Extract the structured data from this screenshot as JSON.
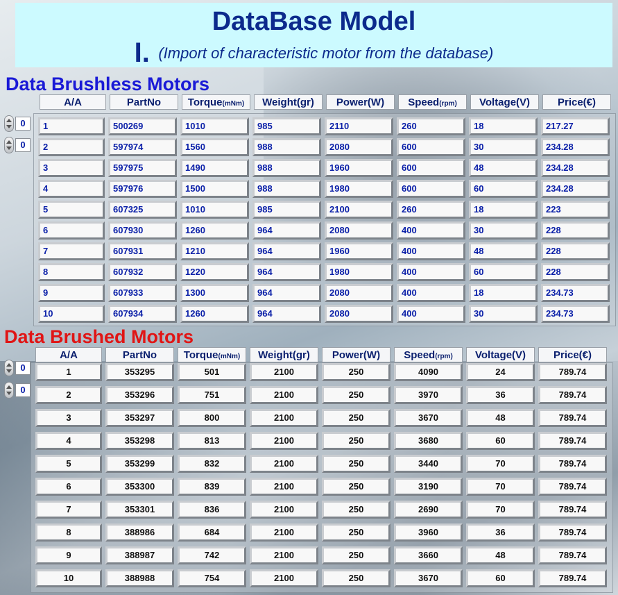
{
  "header": {
    "title": "DataBase Model",
    "roman": "I.",
    "subtitle": "(Import of characteristic motor from the database)"
  },
  "brushless": {
    "title": "Data Brushless Motors",
    "spinners": [
      "0",
      "0"
    ],
    "columns": [
      "A/A",
      "PartNo",
      "Torque",
      "Weight(gr)",
      "Power(W)",
      "Speed",
      "Voltage(V)",
      "Price(€)"
    ],
    "torque_unit": "(mNm)",
    "speed_unit": "(rpm)",
    "rows": [
      [
        "1",
        "500269",
        "1010",
        "985",
        "2110",
        "260",
        "18",
        "217.27"
      ],
      [
        "2",
        "597974",
        "1560",
        "988",
        "2080",
        "600",
        "30",
        "234.28"
      ],
      [
        "3",
        "597975",
        "1490",
        "988",
        "1960",
        "600",
        "48",
        "234.28"
      ],
      [
        "4",
        "597976",
        "1500",
        "988",
        "1980",
        "600",
        "60",
        "234.28"
      ],
      [
        "5",
        "607325",
        "1010",
        "985",
        "2100",
        "260",
        "18",
        "223"
      ],
      [
        "6",
        "607930",
        "1260",
        "964",
        "2080",
        "400",
        "30",
        "228"
      ],
      [
        "7",
        "607931",
        "1210",
        "964",
        "1960",
        "400",
        "48",
        "228"
      ],
      [
        "8",
        "607932",
        "1220",
        "964",
        "1980",
        "400",
        "60",
        "228"
      ],
      [
        "9",
        "607933",
        "1300",
        "964",
        "2080",
        "400",
        "18",
        "234.73"
      ],
      [
        "10",
        "607934",
        "1260",
        "964",
        "2080",
        "400",
        "30",
        "234.73"
      ]
    ]
  },
  "brushed": {
    "title": "Data Brushed Motors",
    "spinners": [
      "0",
      "0"
    ],
    "columns": [
      "A/A",
      "PartNo",
      "Torque",
      "Weight(gr)",
      "Power(W)",
      "Speed",
      "Voltage(V)",
      "Price(€)"
    ],
    "torque_unit": "(mNm)",
    "speed_unit": "(rpm)",
    "rows": [
      [
        "1",
        "353295",
        "501",
        "2100",
        "250",
        "4090",
        "24",
        "789.74"
      ],
      [
        "2",
        "353296",
        "751",
        "2100",
        "250",
        "3970",
        "36",
        "789.74"
      ],
      [
        "3",
        "353297",
        "800",
        "2100",
        "250",
        "3670",
        "48",
        "789.74"
      ],
      [
        "4",
        "353298",
        "813",
        "2100",
        "250",
        "3680",
        "60",
        "789.74"
      ],
      [
        "5",
        "353299",
        "832",
        "2100",
        "250",
        "3440",
        "70",
        "789.74"
      ],
      [
        "6",
        "353300",
        "839",
        "2100",
        "250",
        "3190",
        "70",
        "789.74"
      ],
      [
        "7",
        "353301",
        "836",
        "2100",
        "250",
        "2690",
        "70",
        "789.74"
      ],
      [
        "8",
        "388986",
        "684",
        "2100",
        "250",
        "3960",
        "36",
        "789.74"
      ],
      [
        "9",
        "388987",
        "742",
        "2100",
        "250",
        "3660",
        "48",
        "789.74"
      ],
      [
        "10",
        "388988",
        "754",
        "2100",
        "250",
        "3670",
        "60",
        "789.74"
      ]
    ]
  }
}
